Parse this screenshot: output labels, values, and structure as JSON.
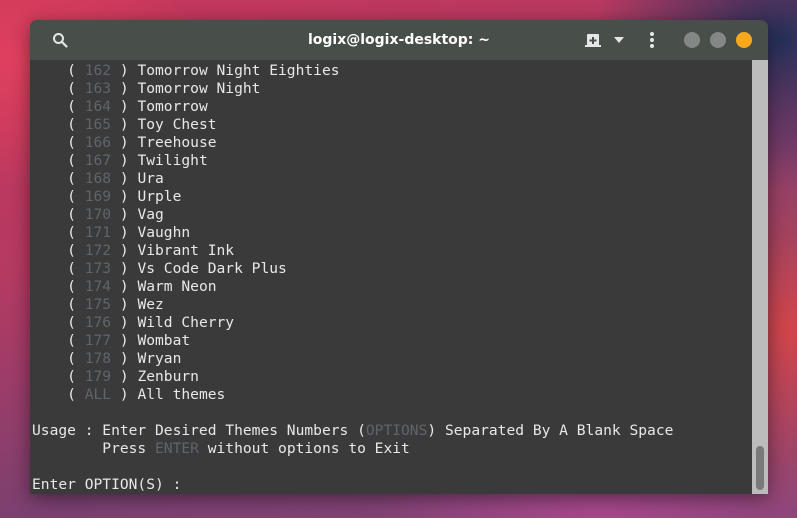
{
  "window": {
    "title": "logix@logix-desktop: ~",
    "colors": {
      "titlebar": "#484e4a",
      "terminal_bg": "#3a3a3a",
      "text": "#e8e8e8",
      "dim_text": "#5f656b",
      "close_button": "#f8a81b",
      "inactive_button": "#838785"
    },
    "icons": [
      "search-icon",
      "new-tab-icon",
      "dropdown-arrow-icon",
      "menu-kebab-icon"
    ]
  },
  "terminal": {
    "themes": [
      {
        "num": "162",
        "name": "Tomorrow Night Eighties"
      },
      {
        "num": "163",
        "name": "Tomorrow Night"
      },
      {
        "num": "164",
        "name": "Tomorrow"
      },
      {
        "num": "165",
        "name": "Toy Chest"
      },
      {
        "num": "166",
        "name": "Treehouse"
      },
      {
        "num": "167",
        "name": "Twilight"
      },
      {
        "num": "168",
        "name": "Ura"
      },
      {
        "num": "169",
        "name": "Urple"
      },
      {
        "num": "170",
        "name": "Vag"
      },
      {
        "num": "171",
        "name": "Vaughn"
      },
      {
        "num": "172",
        "name": "Vibrant Ink"
      },
      {
        "num": "173",
        "name": "Vs Code Dark Plus"
      },
      {
        "num": "174",
        "name": "Warm Neon"
      },
      {
        "num": "175",
        "name": "Wez"
      },
      {
        "num": "176",
        "name": "Wild Cherry"
      },
      {
        "num": "177",
        "name": "Wombat"
      },
      {
        "num": "178",
        "name": "Wryan"
      },
      {
        "num": "179",
        "name": "Zenburn"
      },
      {
        "num": "ALL",
        "name": "All themes"
      }
    ],
    "open_paren": "    ( ",
    "close_paren": " ) ",
    "usage": {
      "line1_prefix": "Usage : Enter Desired Themes Numbers (",
      "line1_highlight": "OPTIONS",
      "line1_suffix": ") Separated By A Blank Space",
      "line2_prefix": "        Press ",
      "line2_highlight": "ENTER",
      "line2_suffix": " without options to Exit"
    },
    "prompt": "Enter OPTION(S) : ",
    "input_value": ""
  }
}
